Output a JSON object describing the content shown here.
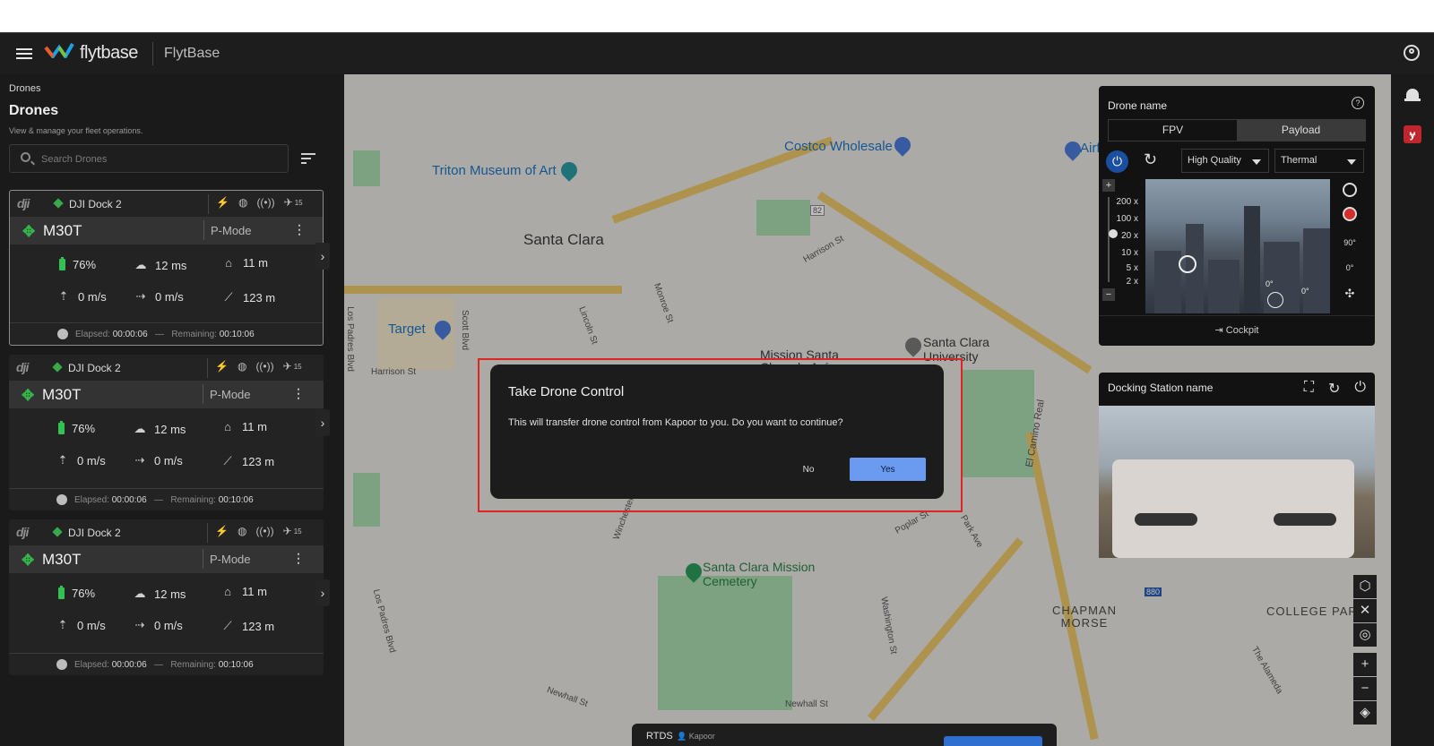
{
  "header": {
    "brand_logo_text": "flytbase",
    "brand_name": "FlytBase"
  },
  "sidebar": {
    "breadcrumb": "Drones",
    "title": "Drones",
    "subtitle": "View & manage your fleet operations.",
    "search_placeholder": "Search Drones",
    "cards": [
      {
        "dock_brand": "dji",
        "dock_name": "DJI Dock 2",
        "satellites": "15",
        "model": "M30T",
        "mode": "P-Mode",
        "battery": "76%",
        "latency": "12 ms",
        "home_distance": "11 m",
        "vertical_speed": "0 m/s",
        "horizontal_speed": "0 m/s",
        "altitude": "123 m",
        "elapsed_label": "Elapsed:",
        "elapsed_value": "00:00:06",
        "separator": "—",
        "remaining_label": "Remaining:",
        "remaining_value": "00:10:06"
      },
      {
        "dock_brand": "dji",
        "dock_name": "DJI Dock 2",
        "satellites": "15",
        "model": "M30T",
        "mode": "P-Mode",
        "battery": "76%",
        "latency": "12 ms",
        "home_distance": "11 m",
        "vertical_speed": "0 m/s",
        "horizontal_speed": "0 m/s",
        "altitude": "123 m",
        "elapsed_label": "Elapsed:",
        "elapsed_value": "00:00:06",
        "separator": "—",
        "remaining_label": "Remaining:",
        "remaining_value": "00:10:06"
      },
      {
        "dock_brand": "dji",
        "dock_name": "DJI Dock 2",
        "satellites": "15",
        "model": "M30T",
        "mode": "P-Mode",
        "battery": "76%",
        "latency": "12 ms",
        "home_distance": "11 m",
        "vertical_speed": "0 m/s",
        "horizontal_speed": "0 m/s",
        "altitude": "123 m",
        "elapsed_label": "Elapsed:",
        "elapsed_value": "00:00:06",
        "separator": "—",
        "remaining_label": "Remaining:",
        "remaining_value": "00:10:06"
      }
    ]
  },
  "map": {
    "labels": {
      "costco": "Costco Wholesale",
      "triton": "Triton Museum of Art",
      "santa_clara": "Santa Clara",
      "target": "Target",
      "mission": "Mission Santa Clara de Asís",
      "scu": "Santa Clara University",
      "cemetery": "Santa Clara Mission Cemetery",
      "chapman": "CHAPMAN MORSE",
      "college_park": "COLLEGE PAR",
      "harrison1": "Harrison St",
      "harrison2": "Harrison St",
      "lincoln": "Lincoln St",
      "monroe": "Monroe St",
      "scott": "Scott Blvd",
      "los_padres": "Los Padres Blvd",
      "los_padres2": "Los Padres Blvd",
      "winchester": "Winchester Blvd",
      "newhall": "Newhall St",
      "newhall2": "Newhall St",
      "poplar": "Poplar St",
      "park_ave": "Park Ave",
      "washington": "Washington St",
      "el_camino": "El Camino Real",
      "alameda": "The Alameda",
      "route82": "82",
      "route880": "880",
      "airf": "Airf"
    }
  },
  "drone_panel": {
    "title": "Drone name",
    "tabs": [
      "FPV",
      "Payload"
    ],
    "quality": "High Quality",
    "mode": "Thermal",
    "zoom_levels": [
      "200 x",
      "100 x",
      "20 x",
      "10 x",
      "5 x",
      "2 x"
    ],
    "gimbal_90": "90°",
    "gimbal_0": "0°",
    "cam_0a": "0°",
    "cam_0b": "0°",
    "cockpit": "Cockpit"
  },
  "dock_panel": {
    "title": "Docking Station name"
  },
  "bottom_bar": {
    "label": "RTDS",
    "user": "Kapoor"
  },
  "dialog": {
    "title": "Take Drone Control",
    "body": "This will transfer drone control from Kapoor to you. Do you want to continue?",
    "no": "No",
    "yes": "Yes"
  }
}
